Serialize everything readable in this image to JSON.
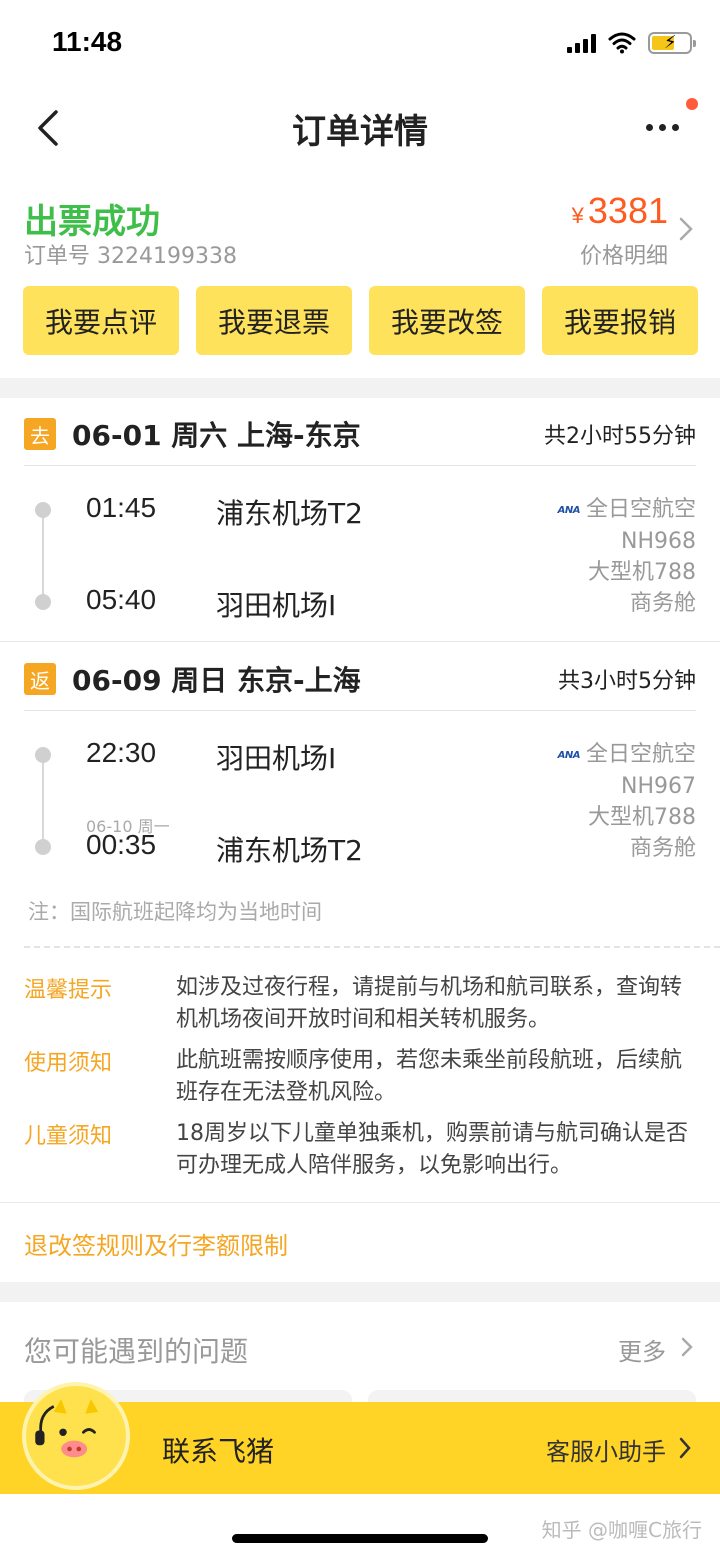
{
  "status_bar": {
    "time": "11:48"
  },
  "nav": {
    "title": "订单详情"
  },
  "summary": {
    "status": "出票成功",
    "order_number": "订单号 3224199338",
    "currency": "¥",
    "price": "3381",
    "price_detail": "价格明细"
  },
  "actions": [
    "我要点评",
    "我要退票",
    "我要改签",
    "我要报销"
  ],
  "legs": [
    {
      "tag": "去",
      "route": "06-01 周六 上海-东京",
      "duration": "共2小时55分钟",
      "dep_time": "01:45",
      "dep_airport": "浦东机场T2",
      "arr_time": "05:40",
      "arr_airport": "羽田机场I",
      "arr_date_note": "",
      "airline_logo": "ANA",
      "airline": "全日空航空",
      "flight_no": "NH968",
      "aircraft": "大型机788",
      "cabin": "商务舱"
    },
    {
      "tag": "返",
      "route": "06-09 周日 东京-上海",
      "duration": "共3小时5分钟",
      "dep_time": "22:30",
      "dep_airport": "羽田机场I",
      "arr_time": "00:35",
      "arr_airport": "浦东机场T2",
      "arr_date_note": "06-10 周一",
      "airline_logo": "ANA",
      "airline": "全日空航空",
      "flight_no": "NH967",
      "aircraft": "大型机788",
      "cabin": "商务舱"
    }
  ],
  "note": "注：国际航班起降均为当地时间",
  "tips": [
    {
      "label": "温馨提示",
      "text": "如涉及过夜行程，请提前与机场和航司联系，查询转机机场夜间开放时间和相关转机服务。"
    },
    {
      "label": "使用须知",
      "text": "此航班需按顺序使用，若您未乘坐前段航班，后续航班存在无法登机风险。"
    },
    {
      "label": "儿童须知",
      "text": "18周岁以下儿童单独乘机，购票前请与航司确认是否可办理无成人陪伴服务，以免影响出行。"
    }
  ],
  "rules_link": "退改签规则及行李额限制",
  "faq": {
    "title": "您可能遇到的问题",
    "more": "更多"
  },
  "contact": {
    "label": "联系飞猪",
    "assistant": "客服小助手"
  },
  "watermark": "知乎 @咖喱C旅行",
  "colors": {
    "success": "#3fbf4a",
    "price": "#ff5a1f",
    "button": "#ffe25c",
    "accent": "#f5a623",
    "contact_bar": "#ffd426"
  }
}
